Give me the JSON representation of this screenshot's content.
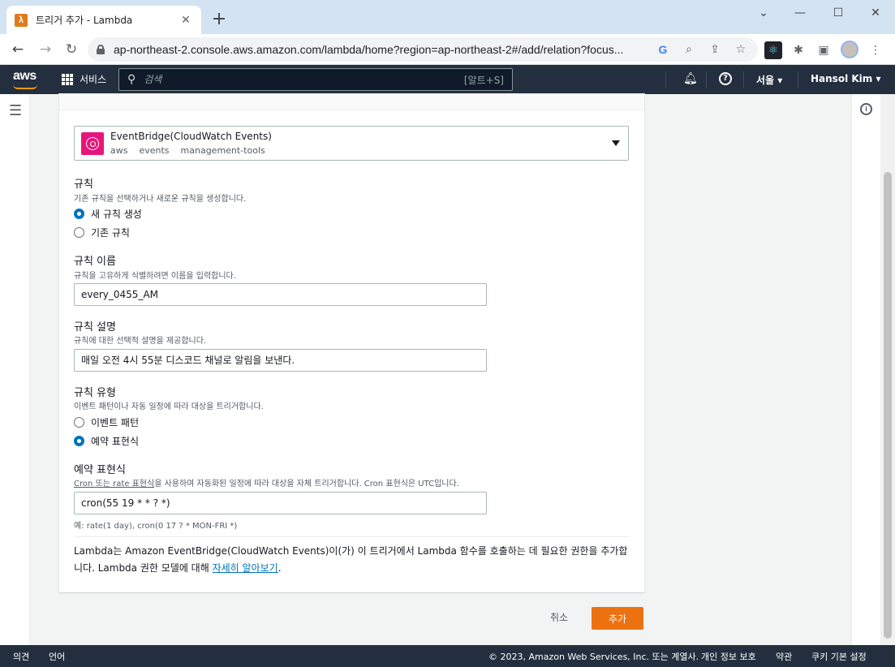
{
  "browser": {
    "tab_title": "트리거 추가 - Lambda",
    "tab_favicon": "λ",
    "url": "ap-northeast-2.console.aws.amazon.com/lambda/home?region=ap-northeast-2#/add/relation?focus..."
  },
  "header": {
    "logo": "aws",
    "services_label": "서비스",
    "search_placeholder": "검색",
    "search_shortcut": "[알트+S]",
    "region": "서울 ▾",
    "user": "Hansol Kim ▾"
  },
  "trigger": {
    "name": "EventBridge(CloudWatch Events)",
    "tags": [
      "aws",
      "events",
      "management-tools"
    ]
  },
  "rule": {
    "label": "규칙",
    "description": "기존 규칙을 선택하거나 새로운 규칙을 생성합니다.",
    "options": [
      "새 규칙 생성",
      "기존 규칙"
    ]
  },
  "rule_name": {
    "label": "규칙 이름",
    "description": "규칙을 고유하게 식별하려면 이름을 입력합니다.",
    "value": "every_0455_AM"
  },
  "rule_desc": {
    "label": "규칙 설명",
    "description": "규칙에 대한 선택적 설명을 제공합니다.",
    "value": "매일 오전 4시 55분 디스코드 채널로 알림을 보낸다."
  },
  "rule_type": {
    "label": "규칙 유형",
    "description": "이벤트 패턴이나 자동 일정에 따라 대상을 트리거합니다.",
    "options": [
      "이벤트 패턴",
      "예약 표현식"
    ]
  },
  "schedule": {
    "label": "예약 표현식",
    "desc_link": "Cron 또는 rate 표현식",
    "desc_rest": "을 사용하여 자동화된 일정에 따라 대상을 자체 트리거합니다. Cron 표현식은 UTC입니다.",
    "value": "cron(55 19 * * ? *)",
    "hint": "예: rate(1 day), cron(0 17 ? * MON-FRI *)"
  },
  "notice": {
    "text": "Lambda는 Amazon EventBridge(CloudWatch Events)이(가) 이 트리거에서 Lambda 함수를 호출하는 데 필요한 권한을 추가합니다. Lambda 권한 모델에 대해 ",
    "link": "자세히 알아보기",
    "end": "."
  },
  "actions": {
    "cancel": "취소",
    "add": "추가"
  },
  "footer": {
    "feedback": "의견",
    "language": "언어",
    "copyright": "© 2023, Amazon Web Services, Inc. 또는 계열사.",
    "privacy": "개인 정보 보호",
    "terms": "약관",
    "cookies": "쿠키 기본 설정"
  },
  "colors": {
    "accent": "#0073bb",
    "primary_button": "#ec7211",
    "header_bg": "#232f3e",
    "eventbridge_icon": "#e7157b"
  }
}
